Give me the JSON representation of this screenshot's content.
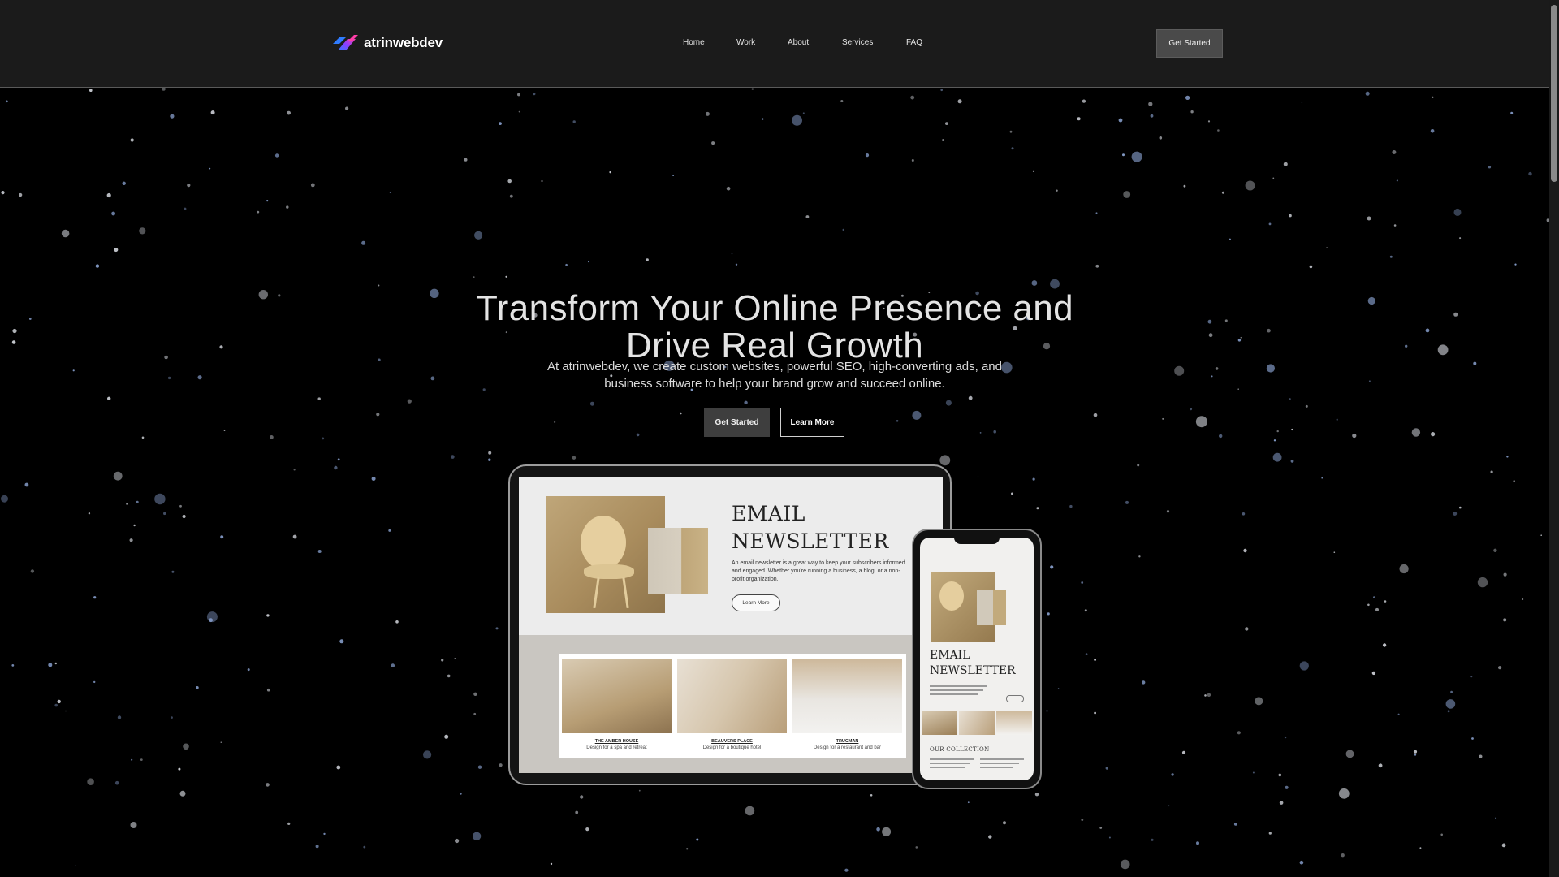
{
  "brand": {
    "name": "atrinwebdev",
    "logo_colors": [
      "#2f7bff",
      "#8b3dff",
      "#ff3fa8"
    ]
  },
  "nav": {
    "items": [
      {
        "label": "Home"
      },
      {
        "label": "Work"
      },
      {
        "label": "About"
      },
      {
        "label": "Services"
      },
      {
        "label": "FAQ"
      }
    ],
    "cta_label": "Get Started"
  },
  "hero": {
    "title_line1": "Transform Your Online Presence and",
    "title_line2": "Drive Real Growth",
    "subtitle_line1": "At atrinwebdev, we create custom websites, powerful SEO, high-converting ads, and",
    "subtitle_line2": "business software to help your brand grow and succeed online.",
    "primary_button": "Get Started",
    "secondary_button": "Learn More"
  },
  "mockup": {
    "tablet": {
      "heading_line1": "EMAIL",
      "heading_line2": "NEWSLETTER",
      "body": "An email newsletter is a great way to keep your subscribers informed and engaged. Whether you're running a business, a blog, or a non-profit organization.",
      "button": "Learn More",
      "cards": [
        {
          "title": "THE AMBER HOUSE",
          "desc": "Design for a spa and retreat"
        },
        {
          "title": "BEAUVERS PLACE",
          "desc": "Design for a boutique hotel"
        },
        {
          "title": "TRUCMAN",
          "desc": "Design for a restaurant and bar"
        }
      ]
    },
    "phone": {
      "heading_line1": "EMAIL",
      "heading_line2": "NEWSLETTER",
      "subheading": "OUR COLLECTION"
    }
  },
  "colors": {
    "header_bg": "#1b1b1b",
    "page_bg": "#000000",
    "cta_bg": "#4a4a4a"
  }
}
